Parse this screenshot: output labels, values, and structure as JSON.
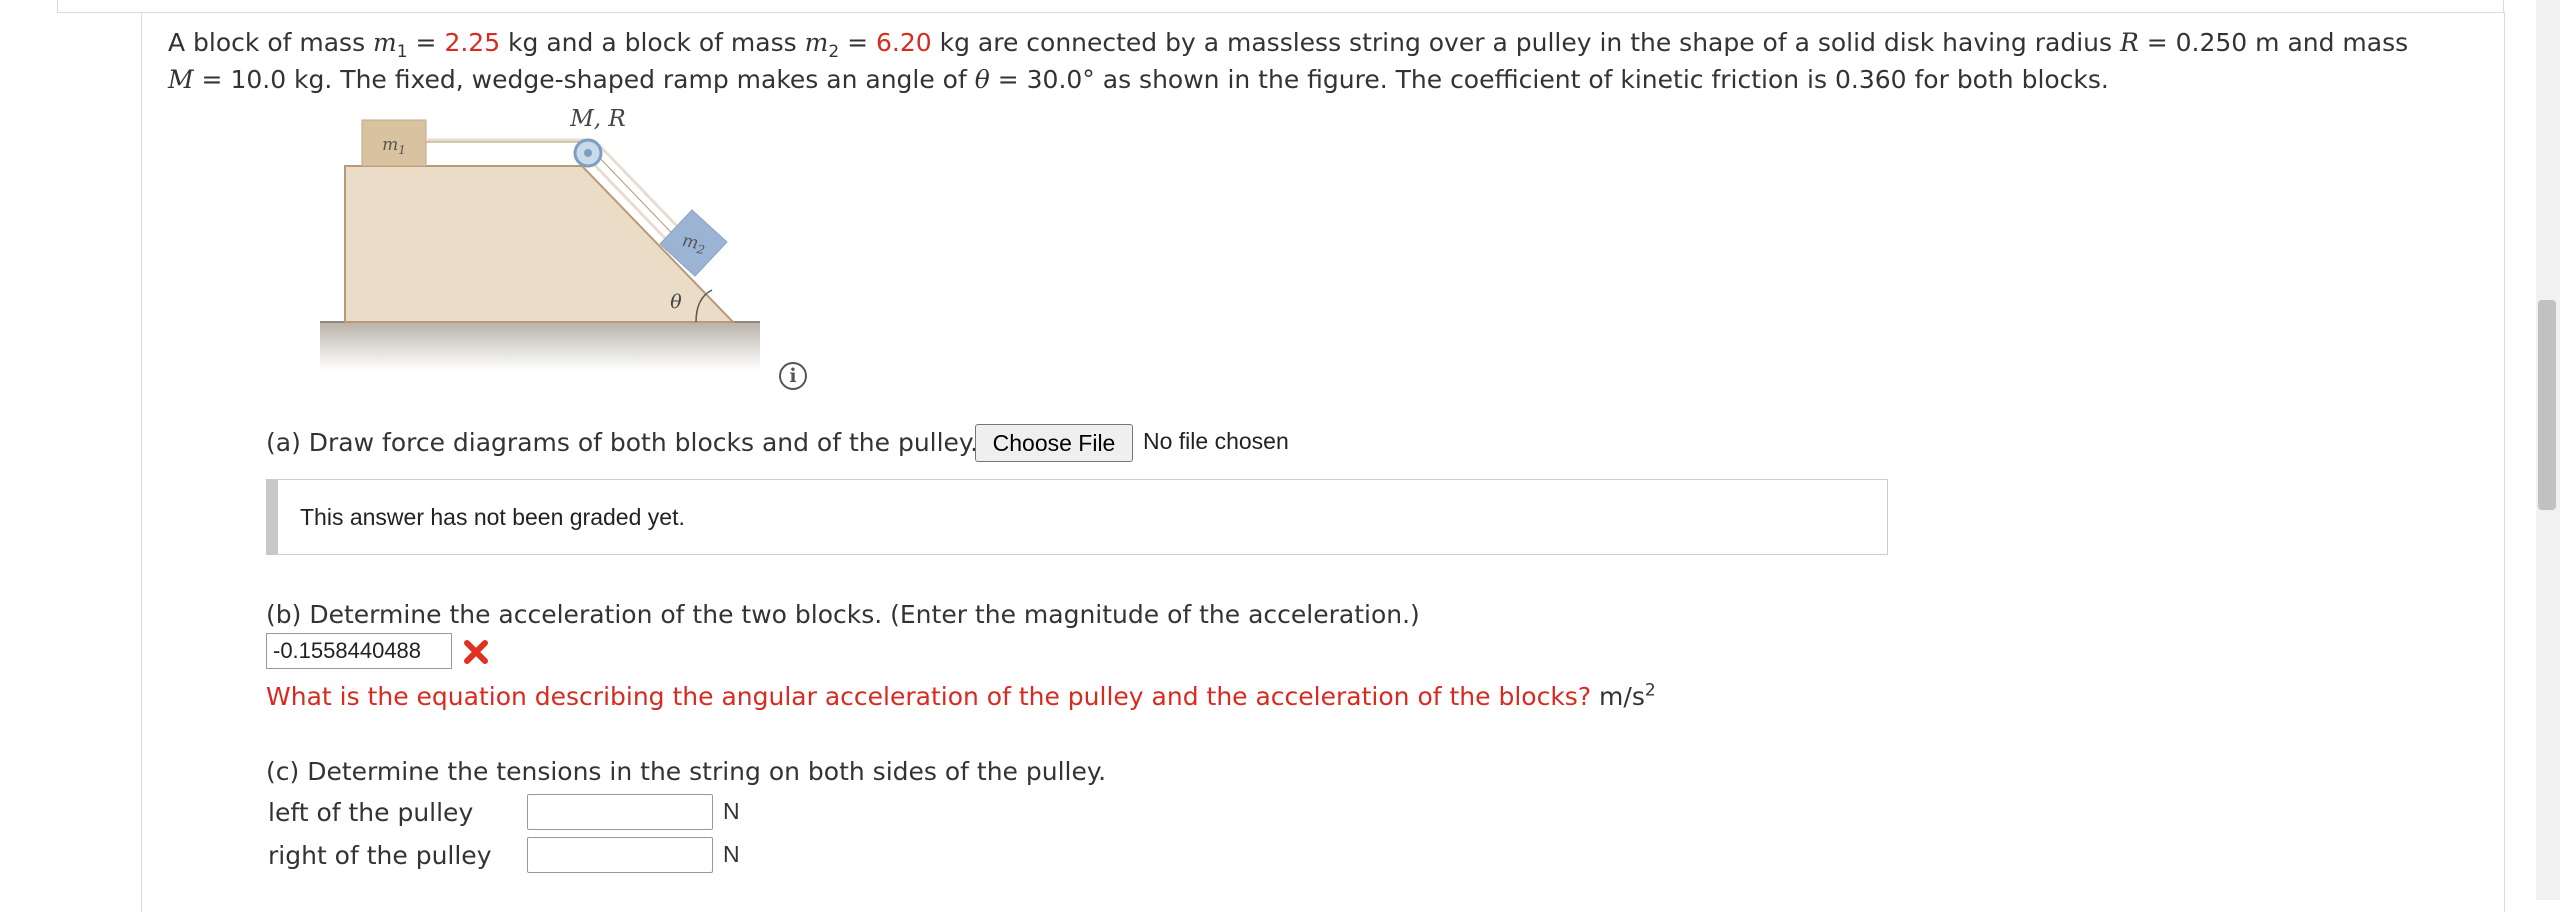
{
  "problem": {
    "p1": "A block of mass ",
    "m1_sym": "m",
    "m1_sub": "1",
    "eq": " = ",
    "m1_val": "2.25",
    "p2": " kg and a block of mass ",
    "m2_sym": "m",
    "m2_sub": "2",
    "eq2": " = ",
    "m2_val": "6.20",
    "p3": " kg are connected by a massless string over a pulley in the shape of a solid disk having radius ",
    "R_sym": "R",
    "p4": " = 0.250 m and mass",
    "M_sym": "M",
    "p5": " = 10.0 kg. The fixed, wedge-shaped ramp makes an angle of ",
    "theta_sym": "θ",
    "p6": " = 30.0° as shown in the figure. The coefficient of kinetic friction is 0.360 for both blocks."
  },
  "figure": {
    "label_MR": "M, R",
    "label_m1": "m",
    "label_m1_sub": "1",
    "label_m2": "m",
    "label_m2_sub": "2",
    "label_theta": "θ"
  },
  "info_icon": {
    "symbol": "i",
    "icon": "info-icon"
  },
  "part_a": {
    "question": "(a) Draw force diagrams of both blocks and of the pulley.",
    "button_label": "Choose File",
    "file_status": "No file chosen",
    "grade_status": "This answer has not been graded yet."
  },
  "part_b": {
    "question": "(b) Determine the acceleration of the two blocks. (Enter the magnitude of the acceleration.)",
    "answer_value": "-0.1558440488",
    "status_icon": "wrong-x-icon",
    "hint": "What is the equation describing the angular acceleration of the pulley and the acceleration of the blocks?",
    "unit": "m/s",
    "unit_sup": "2"
  },
  "part_c": {
    "question": "(c) Determine the tensions in the string on both sides of the pulley.",
    "left_label": "left of the pulley",
    "left_value": "",
    "left_unit": "N",
    "right_label": "right of the pulley",
    "right_value": "",
    "right_unit": "N"
  },
  "colors": {
    "accent_red": "#d82a20",
    "text": "#333333",
    "block_tan": "#d9c2a0",
    "block_blue": "#9cb4d4",
    "wedge_fill": "#ebdcc8"
  }
}
